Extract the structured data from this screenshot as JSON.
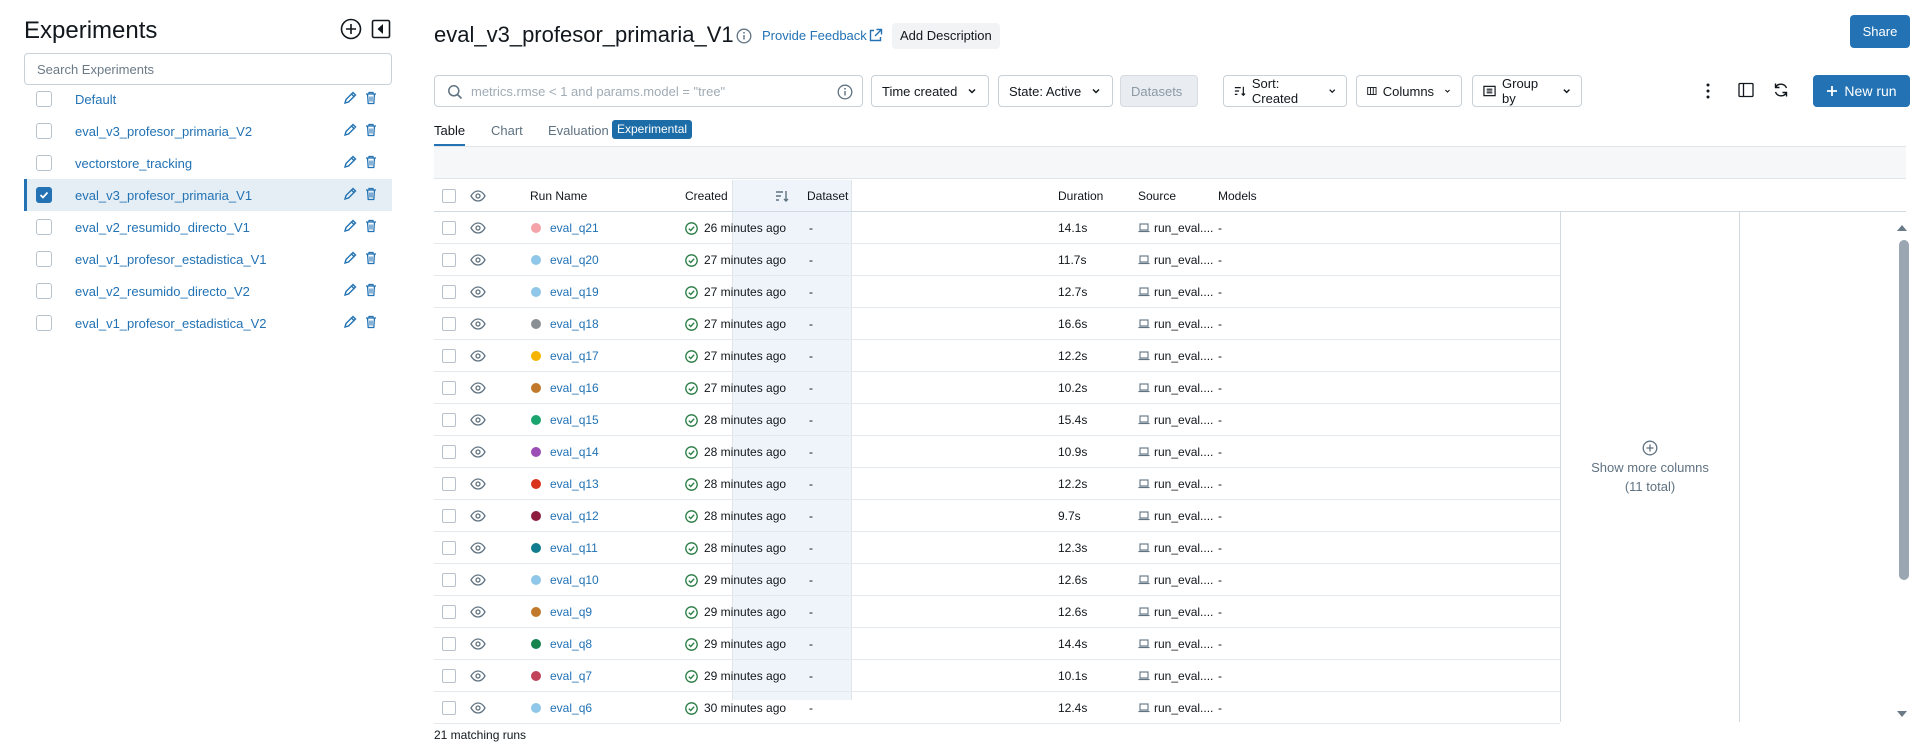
{
  "sidebar": {
    "title": "Experiments",
    "search_placeholder": "Search Experiments",
    "experiments": [
      {
        "name": "Default",
        "active": false
      },
      {
        "name": "eval_v3_profesor_primaria_V2",
        "active": false
      },
      {
        "name": "vectorstore_tracking",
        "active": false
      },
      {
        "name": "eval_v3_profesor_primaria_V1",
        "active": true
      },
      {
        "name": "eval_v2_resumido_directo_V1",
        "active": false
      },
      {
        "name": "eval_v1_profesor_estadistica_V1",
        "active": false
      },
      {
        "name": "eval_v2_resumido_directo_V2",
        "active": false
      },
      {
        "name": "eval_v1_profesor_estadistica_V2",
        "active": false
      }
    ]
  },
  "header": {
    "title": "eval_v3_profesor_primaria_V1",
    "feedback_label": "Provide Feedback",
    "add_description_label": "Add Description",
    "share_label": "Share"
  },
  "toolbar": {
    "filter_placeholder": "metrics.rmse < 1 and params.model = \"tree\"",
    "time_created_label": "Time created",
    "state_label": "State: Active",
    "datasets_label": "Datasets",
    "sort_label": "Sort: Created",
    "columns_label": "Columns",
    "group_by_label": "Group by",
    "new_run_label": "New run"
  },
  "tabs": {
    "table": "Table",
    "chart": "Chart",
    "evaluation": "Evaluation",
    "experimental_badge": "Experimental"
  },
  "table": {
    "headers": {
      "run_name": "Run Name",
      "created": "Created",
      "dataset": "Dataset",
      "duration": "Duration",
      "source": "Source",
      "models": "Models"
    },
    "rows": [
      {
        "name": "eval_q21",
        "color": "#f4a3a8",
        "created": "26 minutes ago",
        "dataset": "-",
        "duration": "14.1s",
        "source": "run_eval....",
        "models": "-"
      },
      {
        "name": "eval_q20",
        "color": "#8fc7e8",
        "created": "27 minutes ago",
        "dataset": "-",
        "duration": "11.7s",
        "source": "run_eval....",
        "models": "-"
      },
      {
        "name": "eval_q19",
        "color": "#8fc7e8",
        "created": "27 minutes ago",
        "dataset": "-",
        "duration": "12.7s",
        "source": "run_eval....",
        "models": "-"
      },
      {
        "name": "eval_q18",
        "color": "#8a8f94",
        "created": "27 minutes ago",
        "dataset": "-",
        "duration": "16.6s",
        "source": "run_eval....",
        "models": "-"
      },
      {
        "name": "eval_q17",
        "color": "#f5b400",
        "created": "27 minutes ago",
        "dataset": "-",
        "duration": "12.2s",
        "source": "run_eval....",
        "models": "-"
      },
      {
        "name": "eval_q16",
        "color": "#c07a2c",
        "created": "27 minutes ago",
        "dataset": "-",
        "duration": "10.2s",
        "source": "run_eval....",
        "models": "-"
      },
      {
        "name": "eval_q15",
        "color": "#1aa56e",
        "created": "28 minutes ago",
        "dataset": "-",
        "duration": "15.4s",
        "source": "run_eval....",
        "models": "-"
      },
      {
        "name": "eval_q14",
        "color": "#9b4fb6",
        "created": "28 minutes ago",
        "dataset": "-",
        "duration": "10.9s",
        "source": "run_eval....",
        "models": "-"
      },
      {
        "name": "eval_q13",
        "color": "#d9341e",
        "created": "28 minutes ago",
        "dataset": "-",
        "duration": "12.2s",
        "source": "run_eval....",
        "models": "-"
      },
      {
        "name": "eval_q12",
        "color": "#8c1d40",
        "created": "28 minutes ago",
        "dataset": "-",
        "duration": "9.7s",
        "source": "run_eval....",
        "models": "-"
      },
      {
        "name": "eval_q11",
        "color": "#0f7d8f",
        "created": "28 minutes ago",
        "dataset": "-",
        "duration": "12.3s",
        "source": "run_eval....",
        "models": "-"
      },
      {
        "name": "eval_q10",
        "color": "#8fc7e8",
        "created": "29 minutes ago",
        "dataset": "-",
        "duration": "12.6s",
        "source": "run_eval....",
        "models": "-"
      },
      {
        "name": "eval_q9",
        "color": "#c07a2c",
        "created": "29 minutes ago",
        "dataset": "-",
        "duration": "12.6s",
        "source": "run_eval....",
        "models": "-"
      },
      {
        "name": "eval_q8",
        "color": "#16844f",
        "created": "29 minutes ago",
        "dataset": "-",
        "duration": "14.4s",
        "source": "run_eval....",
        "models": "-"
      },
      {
        "name": "eval_q7",
        "color": "#c2445a",
        "created": "29 minutes ago",
        "dataset": "-",
        "duration": "10.1s",
        "source": "run_eval....",
        "models": "-"
      },
      {
        "name": "eval_q6",
        "color": "#8fc7e8",
        "created": "30 minutes ago",
        "dataset": "-",
        "duration": "12.4s",
        "source": "run_eval....",
        "models": "-"
      }
    ],
    "show_more_line1": "Show more columns",
    "show_more_line2": "(11 total)",
    "matching_runs": "21 matching runs"
  },
  "colors": {
    "accent": "#2272b4",
    "success": "#277c43"
  }
}
